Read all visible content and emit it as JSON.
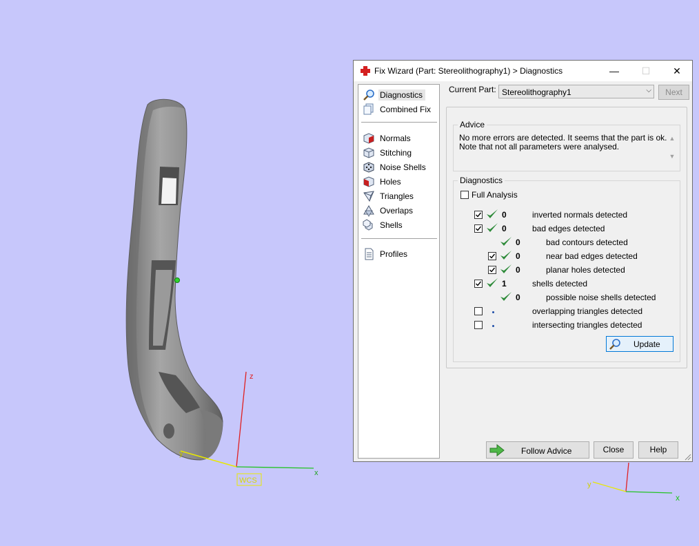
{
  "viewport": {
    "axis_z_label": "z",
    "axis_x_label": "x",
    "axis_y_label": "y",
    "wcs_label": "WCS",
    "mini_axis_x_label": "x",
    "mini_axis_y_label": "y"
  },
  "window": {
    "title": "Fix Wizard (Part: Stereolithography1) > Diagnostics",
    "minimize_glyph": "—",
    "maximize_glyph": "☐",
    "close_glyph": "✕"
  },
  "nav": {
    "items": [
      {
        "label": "Diagnostics",
        "icon": "magnifier-icon"
      },
      {
        "label": "Combined Fix",
        "icon": "pages-icon"
      },
      {
        "label": "Normals",
        "icon": "cube-red-icon"
      },
      {
        "label": "Stitching",
        "icon": "cube-stitch-icon"
      },
      {
        "label": "Noise Shells",
        "icon": "dice-icon"
      },
      {
        "label": "Holes",
        "icon": "cube-hole-icon"
      },
      {
        "label": "Triangles",
        "icon": "triangle-icon"
      },
      {
        "label": "Overlaps",
        "icon": "overlap-icon"
      },
      {
        "label": "Shells",
        "icon": "shells-icon"
      },
      {
        "label": "Profiles",
        "icon": "document-icon"
      }
    ]
  },
  "part": {
    "label": "Current Part:",
    "value": "Stereolithography1",
    "next_label": "Next"
  },
  "advice": {
    "legend": "Advice",
    "line1": "No more errors are detected. It seems that the part is ok.",
    "line2": "Note that not all parameters were analysed."
  },
  "diagnostics": {
    "legend": "Diagnostics",
    "full_analysis_label": "Full Analysis",
    "rows": [
      {
        "count": "0",
        "text": "inverted normals detected"
      },
      {
        "count": "0",
        "text": "bad edges detected"
      },
      {
        "count": "0",
        "text": "bad contours detected"
      },
      {
        "count": "0",
        "text": "near bad edges detected"
      },
      {
        "count": "0",
        "text": "planar holes detected"
      },
      {
        "count": "1",
        "text": "shells detected"
      },
      {
        "count": "0",
        "text": "possible noise shells detected"
      },
      {
        "count": "",
        "text": "overlapping triangles detected"
      },
      {
        "count": "",
        "text": "intersecting triangles detected"
      }
    ],
    "update_label": "Update"
  },
  "footer": {
    "follow_advice_label": "Follow Advice",
    "close_label": "Close",
    "help_label": "Help"
  },
  "colors": {
    "background": "#c7c7fb",
    "model_gray": "#8c8c8c",
    "check_green": "#2e8b3a",
    "axis_red": "#e02020",
    "axis_green": "#22c322",
    "axis_yellow": "#e8e800"
  }
}
